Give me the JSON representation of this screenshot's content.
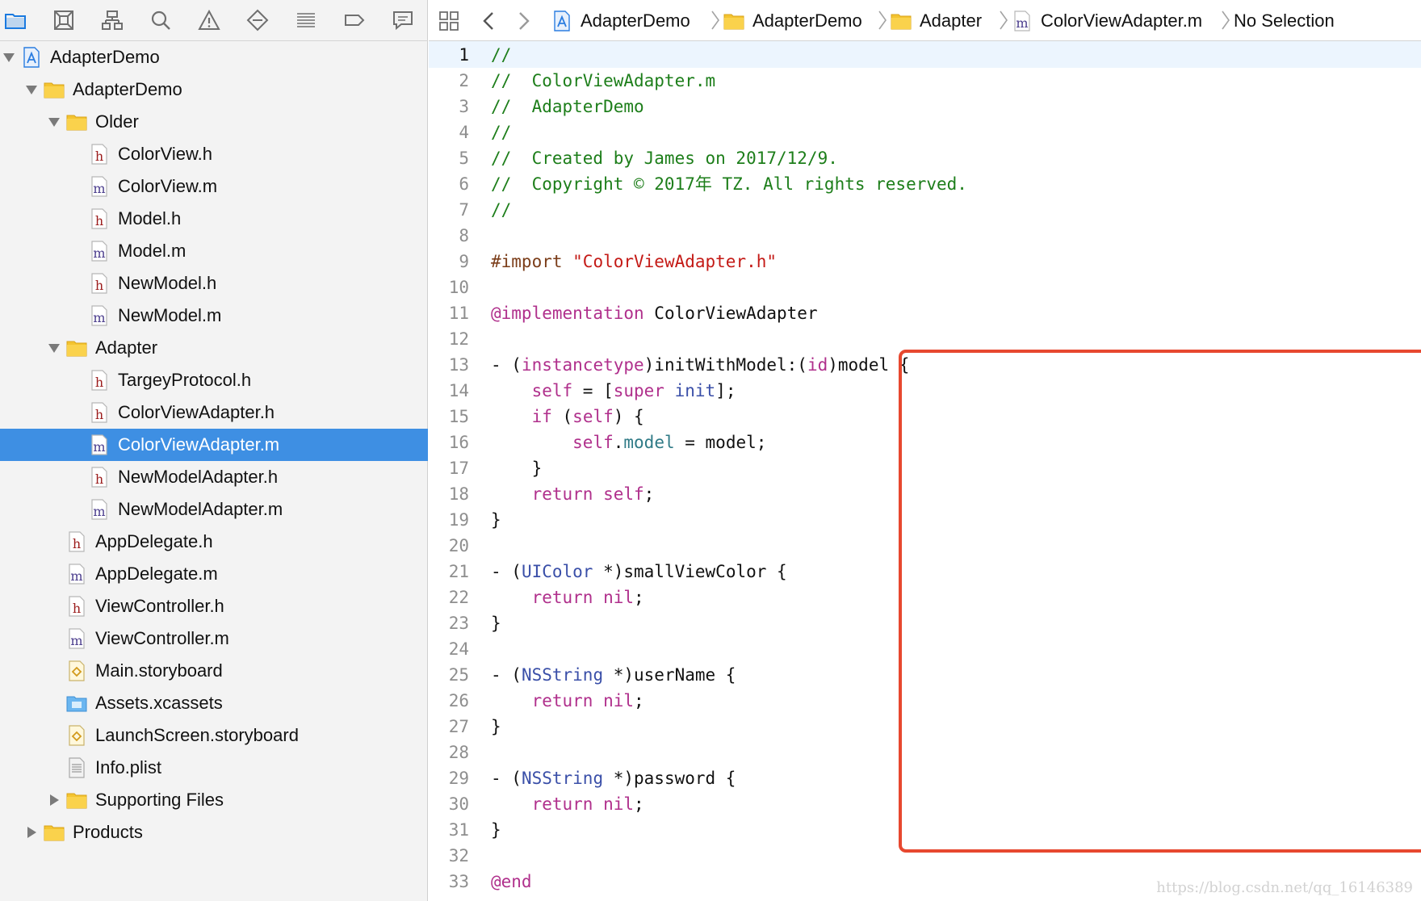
{
  "navigator": {
    "toolbar_icons": [
      "folder-icon",
      "source-control-icon",
      "hierarchy-icon",
      "search-icon",
      "warning-icon",
      "breakpoint-diamond-icon",
      "list-icon",
      "tag-icon",
      "chat-bubble-icon"
    ],
    "tree": [
      {
        "label": "AdapterDemo",
        "type": "project",
        "level": 0,
        "expanded": true
      },
      {
        "label": "AdapterDemo",
        "type": "folder",
        "level": 1,
        "expanded": true
      },
      {
        "label": "Older",
        "type": "folder",
        "level": 2,
        "expanded": true
      },
      {
        "label": "ColorView.h",
        "type": "h",
        "level": 3
      },
      {
        "label": "ColorView.m",
        "type": "m",
        "level": 3
      },
      {
        "label": "Model.h",
        "type": "h",
        "level": 3
      },
      {
        "label": "Model.m",
        "type": "m",
        "level": 3
      },
      {
        "label": "NewModel.h",
        "type": "h",
        "level": 3
      },
      {
        "label": "NewModel.m",
        "type": "m",
        "level": 3
      },
      {
        "label": "Adapter",
        "type": "folder",
        "level": 2,
        "expanded": true
      },
      {
        "label": "TargeyProtocol.h",
        "type": "h",
        "level": 3
      },
      {
        "label": "ColorViewAdapter.h",
        "type": "h",
        "level": 3
      },
      {
        "label": "ColorViewAdapter.m",
        "type": "m",
        "level": 3,
        "selected": true
      },
      {
        "label": "NewModelAdapter.h",
        "type": "h",
        "level": 3
      },
      {
        "label": "NewModelAdapter.m",
        "type": "m",
        "level": 3
      },
      {
        "label": "AppDelegate.h",
        "type": "h",
        "level": 2
      },
      {
        "label": "AppDelegate.m",
        "type": "m",
        "level": 2
      },
      {
        "label": "ViewController.h",
        "type": "h",
        "level": 2
      },
      {
        "label": "ViewController.m",
        "type": "m",
        "level": 2
      },
      {
        "label": "Main.storyboard",
        "type": "storyboard",
        "level": 2
      },
      {
        "label": "Assets.xcassets",
        "type": "assets",
        "level": 2
      },
      {
        "label": "LaunchScreen.storyboard",
        "type": "storyboard",
        "level": 2
      },
      {
        "label": "Info.plist",
        "type": "plist",
        "level": 2
      },
      {
        "label": "Supporting Files",
        "type": "folder",
        "level": 2,
        "expanded": false
      },
      {
        "label": "Products",
        "type": "folder",
        "level": 1,
        "expanded": false
      }
    ]
  },
  "jumpbar": {
    "items": [
      {
        "label": "AdapterDemo",
        "icon": "project"
      },
      {
        "label": "AdapterDemo",
        "icon": "folder"
      },
      {
        "label": "Adapter",
        "icon": "folder"
      },
      {
        "label": "ColorViewAdapter.m",
        "icon": "m"
      },
      {
        "label": "No Selection",
        "icon": "none"
      }
    ]
  },
  "editor": {
    "current_line": 1,
    "lines": [
      [
        [
          "c-com",
          "//"
        ]
      ],
      [
        [
          "c-com",
          "//  ColorViewAdapter.m"
        ]
      ],
      [
        [
          "c-com",
          "//  AdapterDemo"
        ]
      ],
      [
        [
          "c-com",
          "//"
        ]
      ],
      [
        [
          "c-com",
          "//  Created by James on 2017/12/9."
        ]
      ],
      [
        [
          "c-com",
          "//  Copyright © 2017年 TZ. All rights reserved."
        ]
      ],
      [
        [
          "c-com",
          "//"
        ]
      ],
      [],
      [
        [
          "c-pre",
          "#import "
        ],
        [
          "c-str",
          "\"ColorViewAdapter.h\""
        ]
      ],
      [],
      [
        [
          "c-kw",
          "@implementation"
        ],
        [
          "c-plain",
          " ColorViewAdapter"
        ]
      ],
      [],
      [
        [
          "c-plain",
          "- ("
        ],
        [
          "c-kw",
          "instancetype"
        ],
        [
          "c-plain",
          ")initWithModel:("
        ],
        [
          "c-kw",
          "id"
        ],
        [
          "c-plain",
          ")model {"
        ]
      ],
      [
        [
          "c-plain",
          "    "
        ],
        [
          "c-kw",
          "self"
        ],
        [
          "c-plain",
          " = ["
        ],
        [
          "c-kw",
          "super"
        ],
        [
          "c-plain",
          " "
        ],
        [
          "c-type",
          "init"
        ],
        [
          "c-plain",
          "];"
        ]
      ],
      [
        [
          "c-plain",
          "    "
        ],
        [
          "c-kw",
          "if"
        ],
        [
          "c-plain",
          " ("
        ],
        [
          "c-kw",
          "self"
        ],
        [
          "c-plain",
          ") {"
        ]
      ],
      [
        [
          "c-plain",
          "        "
        ],
        [
          "c-kw",
          "self"
        ],
        [
          "c-plain",
          "."
        ],
        [
          "c-prop",
          "model"
        ],
        [
          "c-plain",
          " = model;"
        ]
      ],
      [
        [
          "c-plain",
          "    }"
        ]
      ],
      [
        [
          "c-plain",
          "    "
        ],
        [
          "c-kw",
          "return"
        ],
        [
          "c-plain",
          " "
        ],
        [
          "c-kw",
          "self"
        ],
        [
          "c-plain",
          ";"
        ]
      ],
      [
        [
          "c-plain",
          "}"
        ]
      ],
      [],
      [
        [
          "c-plain",
          "- ("
        ],
        [
          "c-type",
          "UIColor"
        ],
        [
          "c-plain",
          " *)smallViewColor {"
        ]
      ],
      [
        [
          "c-plain",
          "    "
        ],
        [
          "c-kw",
          "return"
        ],
        [
          "c-plain",
          " "
        ],
        [
          "c-kw",
          "nil"
        ],
        [
          "c-plain",
          ";"
        ]
      ],
      [
        [
          "c-plain",
          "}"
        ]
      ],
      [],
      [
        [
          "c-plain",
          "- ("
        ],
        [
          "c-type",
          "NSString"
        ],
        [
          "c-plain",
          " *)userName {"
        ]
      ],
      [
        [
          "c-plain",
          "    "
        ],
        [
          "c-kw",
          "return"
        ],
        [
          "c-plain",
          " "
        ],
        [
          "c-kw",
          "nil"
        ],
        [
          "c-plain",
          ";"
        ]
      ],
      [
        [
          "c-plain",
          "}"
        ]
      ],
      [],
      [
        [
          "c-plain",
          "- ("
        ],
        [
          "c-type",
          "NSString"
        ],
        [
          "c-plain",
          " *)password {"
        ]
      ],
      [
        [
          "c-plain",
          "    "
        ],
        [
          "c-kw",
          "return"
        ],
        [
          "c-plain",
          " "
        ],
        [
          "c-kw",
          "nil"
        ],
        [
          "c-plain",
          ";"
        ]
      ],
      [
        [
          "c-plain",
          "}"
        ]
      ],
      [],
      [
        [
          "c-kw",
          "@end"
        ]
      ]
    ]
  },
  "watermark": "https://blog.csdn.net/qq_16146389",
  "colors": {
    "selection": "#3e8fe3",
    "comment": "#1d7e1a",
    "keyword": "#b0308c",
    "string": "#c41a16",
    "highlight_box": "#e7482f"
  }
}
